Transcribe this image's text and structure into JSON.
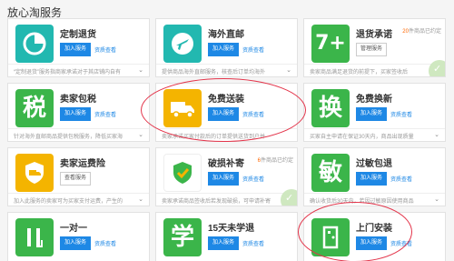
{
  "page": {
    "title": "放心淘服务"
  },
  "cards": [
    {
      "title": "定制退货",
      "icon": "clock-pie-icon",
      "icon_color": "#22b8b0",
      "primary_button": "加入服务",
      "link": "资质查看",
      "description": "“定制退货”服务指商家承诺对于其店铺内自有"
    },
    {
      "title": "海外直邮",
      "icon": "airplane-icon",
      "icon_color": "#22b8b0",
      "primary_button": "加入服务",
      "link": "资质查看",
      "description": "提供商品海外直邮服务，核查后订单均海外"
    },
    {
      "title": "退货承诺",
      "icon": "seven-plus-icon",
      "icon_color": "#3bb54a",
      "secondary_button": "管理服务",
      "note_count": "20",
      "note_suffix": "件商品已约定",
      "description": "卖家商品满足退货的前提下，买家签收后"
    },
    {
      "title": "卖家包税",
      "icon": "tax-character-icon",
      "glyph": "税",
      "icon_color": "#3bb54a",
      "primary_button": "加入服务",
      "link": "资质查看",
      "description": "针对海外直邮商品提供包税服务，降低买家海"
    },
    {
      "title": "免费送装",
      "icon": "delivery-truck-icon",
      "icon_color": "#f4b400",
      "primary_button": "加入服务",
      "link": "资质查看",
      "description": "卖家承诺买家付款后的订单提供送货到户并"
    },
    {
      "title": "免费换新",
      "icon": "exchange-character-icon",
      "glyph": "换",
      "icon_color": "#3bb54a",
      "primary_button": "加入服务",
      "link": "资质查看",
      "description": "买家自主申请在保证30天内，商品出现质量"
    },
    {
      "title": "卖家运费险",
      "icon": "shield-truck-icon",
      "icon_color": "#f4b400",
      "secondary_button": "查看服务",
      "description": "加入此服务的卖家可为买家支付运费，产生的"
    },
    {
      "title": "破损补寄",
      "icon": "shield-check-icon",
      "icon_color": "#3bb54a",
      "primary_button": "加入服务",
      "link": "资质查看",
      "note_count": "6",
      "note_suffix": "件商品已约定",
      "description": "卖家承诺商品签收后若发现破损，可申请补寄"
    },
    {
      "title": "过敏包退",
      "icon": "allergy-character-icon",
      "glyph": "敏",
      "icon_color": "#3bb54a",
      "primary_button": "加入服务",
      "link": "资质查看",
      "description": "确认收货后30天内，若因过敏原因使用商品"
    },
    {
      "title": "一对一",
      "icon": "one-on-one-icon",
      "icon_color": "#3bb54a",
      "primary_button": "加入服务",
      "link": "资质查看",
      "description": "为买家提供一对一专属服务，全程跟踪"
    },
    {
      "title": "15天未学退",
      "icon": "study-character-icon",
      "glyph": "学",
      "icon_color": "#3bb54a",
      "primary_button": "加入服务",
      "link": "资质查看",
      "description": "买家购买后15天内未开始学习可申请退款"
    },
    {
      "title": "上门安装",
      "icon": "door-install-icon",
      "icon_color": "#3bb54a",
      "primary_button": "加入服务",
      "link": "资质查看",
      "description": "卖家承诺为买家提供上门安装服务"
    }
  ]
}
